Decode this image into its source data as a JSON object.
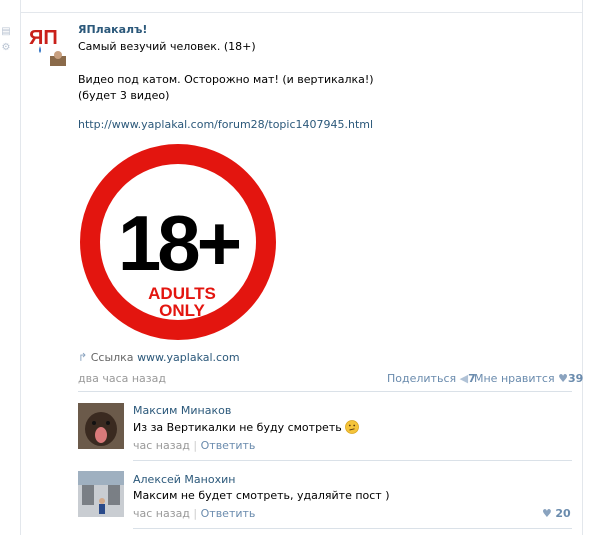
{
  "post": {
    "author": "ЯПлакалъ!",
    "logo_text": "ЯП",
    "title_line": "Самый везучий человек. (18+)",
    "body_line1": "Видео под катом. Осторожно мат! (и вертикалка!)",
    "body_line2": "(будет 3 видео)",
    "url": "http://www.yaplakal.com/forum28/topic1407945.html",
    "image": {
      "big_text": "18+",
      "line1": "ADULTS",
      "line2": "ONLY",
      "ring_color": "#e3150f"
    },
    "attachment_label": "Ссылка",
    "attachment_domain": "www.yaplakal.com",
    "time": "два часа назад",
    "share_label": "Поделиться",
    "share_count": "7",
    "like_label": "Мне нравится",
    "like_count": "39"
  },
  "comments": [
    {
      "author": "Максим Минаков",
      "text": "Из за Вертикалки не буду смотреть",
      "emoji": "confused-face",
      "time": "час назад",
      "reply_label": "Ответить",
      "likes": ""
    },
    {
      "author": "Алексей Манохин",
      "text": "Максим не будет смотреть, удаляйте пост )",
      "time": "час назад",
      "reply_label": "Ответить",
      "likes": "20"
    }
  ],
  "colors": {
    "link": "#2b587a",
    "muted": "#999999",
    "action": "#6a8bad",
    "divider": "#dae1e8"
  }
}
